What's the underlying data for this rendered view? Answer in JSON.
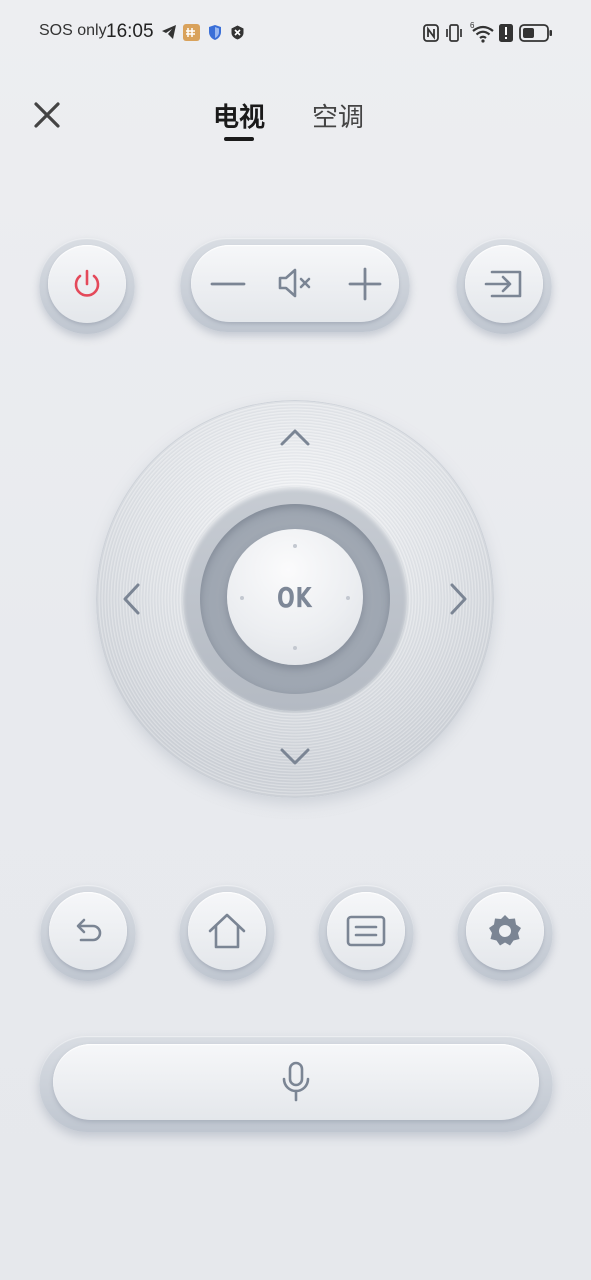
{
  "status_bar": {
    "carrier": "SOS only",
    "time": "16:05",
    "icons": [
      "telegram-icon",
      "app-notification-icon",
      "shield-icon",
      "security-icon",
      "nfc-icon",
      "vibrate-icon",
      "wifi-icon",
      "alert-icon",
      "battery-icon"
    ],
    "wifi_badge": "6"
  },
  "header": {
    "close_icon": "close-icon",
    "tabs": [
      {
        "label": "电视",
        "active": true
      },
      {
        "label": "空调",
        "active": false
      }
    ]
  },
  "top_controls": {
    "power_icon": "power-icon",
    "power_color": "#e4495a",
    "volume_down_icon": "minus-icon",
    "mute_icon": "mute-icon",
    "volume_up_icon": "plus-icon",
    "input_icon": "input-source-icon"
  },
  "dpad": {
    "ok_label": "OK",
    "up_icon": "chevron-up-icon",
    "down_icon": "chevron-down-icon",
    "left_icon": "chevron-left-icon",
    "right_icon": "chevron-right-icon"
  },
  "bottom_controls": {
    "back_icon": "back-icon",
    "home_icon": "home-icon",
    "menu_icon": "menu-icon",
    "settings_icon": "settings-icon"
  },
  "voice": {
    "mic_icon": "microphone-icon"
  },
  "colors": {
    "icon_gray": "#7b8594",
    "accent_red": "#e4495a",
    "background": "#eceef1"
  }
}
